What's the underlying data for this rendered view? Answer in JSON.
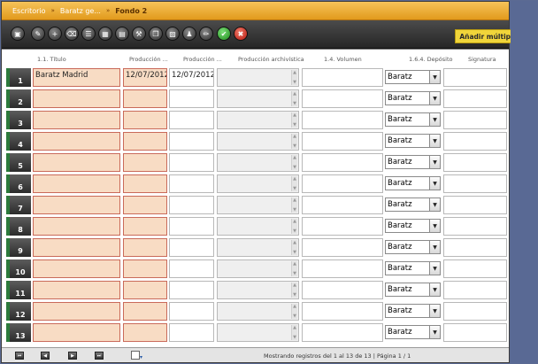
{
  "breadcrumb": {
    "items": [
      "Escritorio",
      "Baratz ge...",
      "Fondo 2"
    ],
    "separator": "»"
  },
  "toolbar": {
    "buttons": [
      {
        "name": "print-icon",
        "glyph": "▣"
      },
      {
        "name": "edit-icon",
        "glyph": "✎"
      },
      {
        "name": "add-icon",
        "glyph": "+"
      },
      {
        "name": "delete-icon",
        "glyph": "⌫"
      },
      {
        "name": "list-icon",
        "glyph": "☰"
      },
      {
        "name": "image-icon",
        "glyph": "▦"
      },
      {
        "name": "catalog-icon",
        "glyph": "▤"
      },
      {
        "name": "tools-icon",
        "glyph": "⚒"
      },
      {
        "name": "copy-icon",
        "glyph": "❐"
      },
      {
        "name": "paste-icon",
        "glyph": "▨"
      },
      {
        "name": "users-icon",
        "glyph": "♟"
      },
      {
        "name": "pencil-icon",
        "glyph": "✏"
      },
      {
        "name": "accept-icon",
        "glyph": "✔"
      },
      {
        "name": "cancel-icon",
        "glyph": "✖"
      }
    ],
    "add_multiple_label": "Añadir múltiple"
  },
  "columns": {
    "titulo": "1.1. Título",
    "prod1": "Producción ...",
    "prod2": "Producción ...",
    "prod_arch": "Producción archivística",
    "volumen": "1.4. Volumen",
    "deposito": "1.6.4. Depósito",
    "signatura": "Signatura"
  },
  "rows": [
    {
      "num": "1",
      "titulo": "Baratz Madrid",
      "prod1": "12/07/2012",
      "prod2": "12/07/2012",
      "deposito": "Baratz"
    },
    {
      "num": "2",
      "titulo": "",
      "prod1": "",
      "prod2": "",
      "deposito": "Baratz"
    },
    {
      "num": "3",
      "titulo": "",
      "prod1": "",
      "prod2": "",
      "deposito": "Baratz"
    },
    {
      "num": "4",
      "titulo": "",
      "prod1": "",
      "prod2": "",
      "deposito": "Baratz"
    },
    {
      "num": "5",
      "titulo": "",
      "prod1": "",
      "prod2": "",
      "deposito": "Baratz"
    },
    {
      "num": "6",
      "titulo": "",
      "prod1": "",
      "prod2": "",
      "deposito": "Baratz"
    },
    {
      "num": "7",
      "titulo": "",
      "prod1": "",
      "prod2": "",
      "deposito": "Baratz"
    },
    {
      "num": "8",
      "titulo": "",
      "prod1": "",
      "prod2": "",
      "deposito": "Baratz"
    },
    {
      "num": "9",
      "titulo": "",
      "prod1": "",
      "prod2": "",
      "deposito": "Baratz"
    },
    {
      "num": "10",
      "titulo": "",
      "prod1": "",
      "prod2": "",
      "deposito": "Baratz"
    },
    {
      "num": "11",
      "titulo": "",
      "prod1": "",
      "prod2": "",
      "deposito": "Baratz"
    },
    {
      "num": "12",
      "titulo": "",
      "prod1": "",
      "prod2": "",
      "deposito": "Baratz"
    },
    {
      "num": "13",
      "titulo": "",
      "prod1": "",
      "prod2": "",
      "deposito": "Baratz"
    }
  ],
  "footer": {
    "status": "Mostrando registros del 1 al 13 de 13 | Página 1 / 1",
    "nav": [
      {
        "name": "first-page-icon",
        "glyph": "⏮"
      },
      {
        "name": "prev-page-icon",
        "glyph": "◀"
      },
      {
        "name": "next-page-icon",
        "glyph": "▶"
      },
      {
        "name": "last-page-icon",
        "glyph": "⏭"
      }
    ]
  },
  "colors": {
    "breadcrumb_bg": "#e9a52a",
    "required_field_bg": "#f8dcc4",
    "add_multiple_bg": "#f0d53a",
    "row_marker_green": "#2c7a3c"
  }
}
